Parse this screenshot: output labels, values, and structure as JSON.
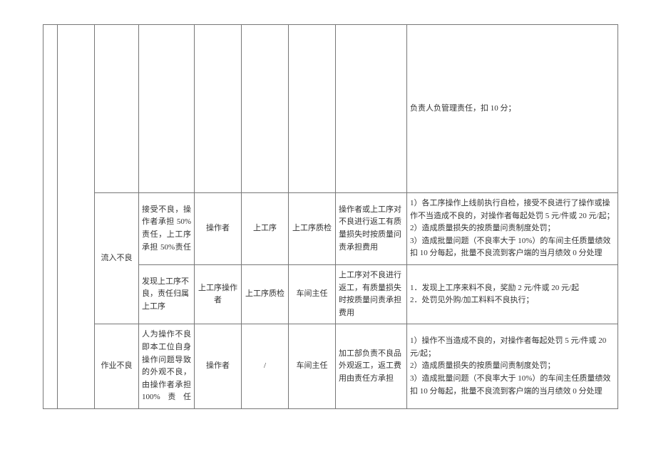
{
  "rows": {
    "r0": {
      "col8": "负责人负管理责任，扣 10 分；"
    },
    "r1": {
      "col2": "流入不良",
      "col3": "接受不良，操作者承担 50%责任，上工序承担 50%责任",
      "col4": "操作者",
      "col5": "上工序",
      "col6": "上工序质检",
      "col7": "操作者或上工序对不良进行返工有质量损失时按质量问责承担费用",
      "col8": "1）各工序操作上线前执行自检，接受不良进行了操作或操作不当造成不良的，对操作者每起处罚 5 元/件或 20 元/起；\n2）造成质量损失的按质量问责制度处罚；\n3）造成批量问题（不良率大于 10%）的车间主任质量绩效扣 10 分每起，批量不良流到客户端的当月绩效 0 分处理"
    },
    "r2": {
      "col3": "发现上工序不良，责任归属上工序",
      "col4": "上工序操作者",
      "col5": "上工序质检",
      "col6": "车间主任",
      "col7": "上工序对不良进行返工，有质量损失时按质量问责承担费用",
      "col8": "1．发现上工序来料不良，奖励 2 元/件或 20 元/起\n2．处罚见外购/加工料料不良执行；"
    },
    "r3": {
      "col2": "作业不良",
      "col3": "人为操作不良即本工位自身操作问题导致的外观不良，由操作者承担 100%责任",
      "col4": "操作者",
      "col5": "/",
      "col6": "车间主任",
      "col7": "加工部负责不良品外观返工，返工费用由责任方承担",
      "col8": "1）操作不当造成不良的，对操作者每起处罚 5 元/件或 20 元/起；\n2）造成质量损失的按质量问责制度处罚；\n3）造成批量问题（不良率大于 10%）的车间主任质量绩效扣 10 分每起，批量不良流到客户端的当月绩效 0 分处理"
    }
  }
}
